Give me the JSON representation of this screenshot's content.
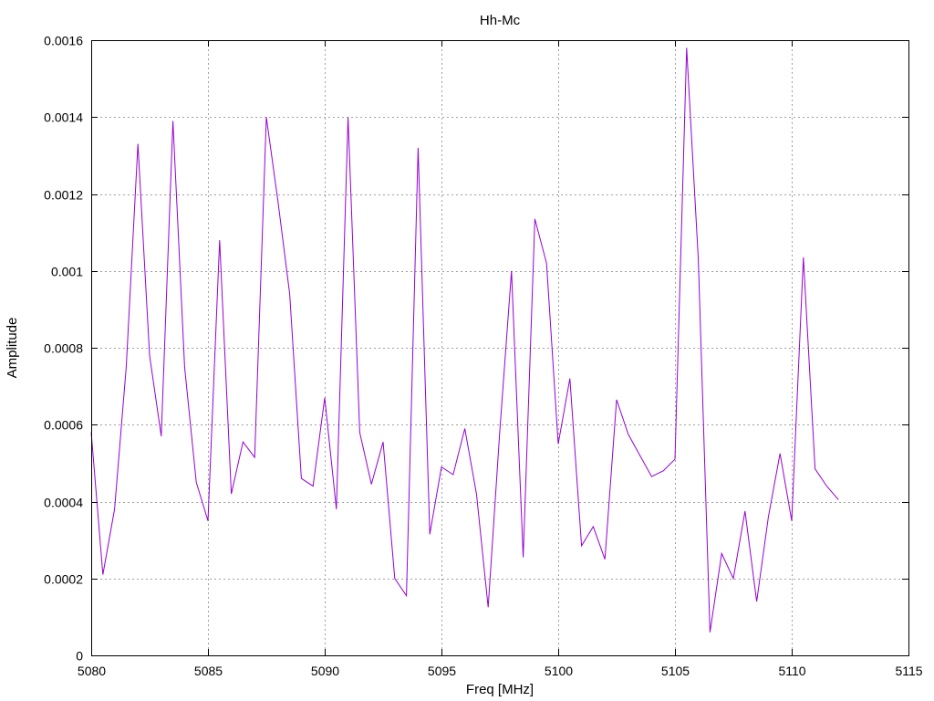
{
  "chart_data": {
    "type": "line",
    "title": "Hh-Mc",
    "xlabel": "Freq [MHz]",
    "ylabel": "Amplitude",
    "xlim": [
      5080,
      5115
    ],
    "ylim": [
      0,
      0.0016
    ],
    "xticks": [
      5080,
      5085,
      5090,
      5095,
      5100,
      5105,
      5110,
      5115
    ],
    "xtick_labels": [
      "5080",
      "5085",
      "5090",
      "5095",
      "5100",
      "5105",
      "5110",
      "5115"
    ],
    "yticks": [
      0,
      0.0002,
      0.0004,
      0.0006,
      0.0008,
      0.001,
      0.0012,
      0.0014,
      0.0016
    ],
    "ytick_labels": [
      "0",
      "0.0002",
      "0.0004",
      "0.0006",
      "0.0008",
      "0.001",
      "0.0012",
      "0.0014",
      "0.0016"
    ],
    "grid": true,
    "color": "#9400d3",
    "series": [
      {
        "x": [
          5080.0,
          5080.5,
          5081.0,
          5081.5,
          5082.0,
          5082.5,
          5083.0,
          5083.5,
          5084.0,
          5084.5,
          5085.0,
          5085.5,
          5086.0,
          5086.5,
          5087.0,
          5087.5,
          5088.0,
          5088.5,
          5089.0,
          5089.5,
          5090.0,
          5090.5,
          5091.0,
          5091.5,
          5092.0,
          5092.5,
          5093.0,
          5093.5,
          5094.0,
          5094.5,
          5095.0,
          5095.5,
          5096.0,
          5096.5,
          5097.0,
          5097.5,
          5098.0,
          5098.5,
          5099.0,
          5099.5,
          5100.0,
          5100.5,
          5101.0,
          5101.5,
          5102.0,
          5102.5,
          5103.0,
          5103.5,
          5104.0,
          5104.5,
          5105.0,
          5105.5,
          5106.0,
          5106.5,
          5107.0,
          5107.5,
          5108.0,
          5108.5,
          5109.0,
          5109.5,
          5110.0,
          5110.5,
          5111.0,
          5111.5,
          5112.0
        ],
        "y": [
          0.00058,
          0.00021,
          0.00038,
          0.00075,
          0.00133,
          0.00078,
          0.00057,
          0.00139,
          0.00075,
          0.00045,
          0.00035,
          0.00108,
          0.00042,
          0.000555,
          0.000515,
          0.0014,
          0.00118,
          0.00094,
          0.00046,
          0.00044,
          0.00067,
          0.00038,
          0.0014,
          0.00058,
          0.000445,
          0.000555,
          0.0002,
          0.000155,
          0.00132,
          0.000315,
          0.00049,
          0.00047,
          0.00059,
          0.00042,
          0.000125,
          0.000585,
          0.001,
          0.000255,
          0.001135,
          0.00102,
          0.00055,
          0.00072,
          0.000285,
          0.000335,
          0.00025,
          0.000665,
          0.000575,
          0.00052,
          0.000465,
          0.00048,
          0.00051,
          0.00158,
          0.00103,
          6e-05,
          0.000265,
          0.0002,
          0.000375,
          0.00014,
          0.00036,
          0.000525,
          0.00035,
          0.001035,
          0.000485,
          0.00044,
          0.000405
        ]
      }
    ]
  }
}
